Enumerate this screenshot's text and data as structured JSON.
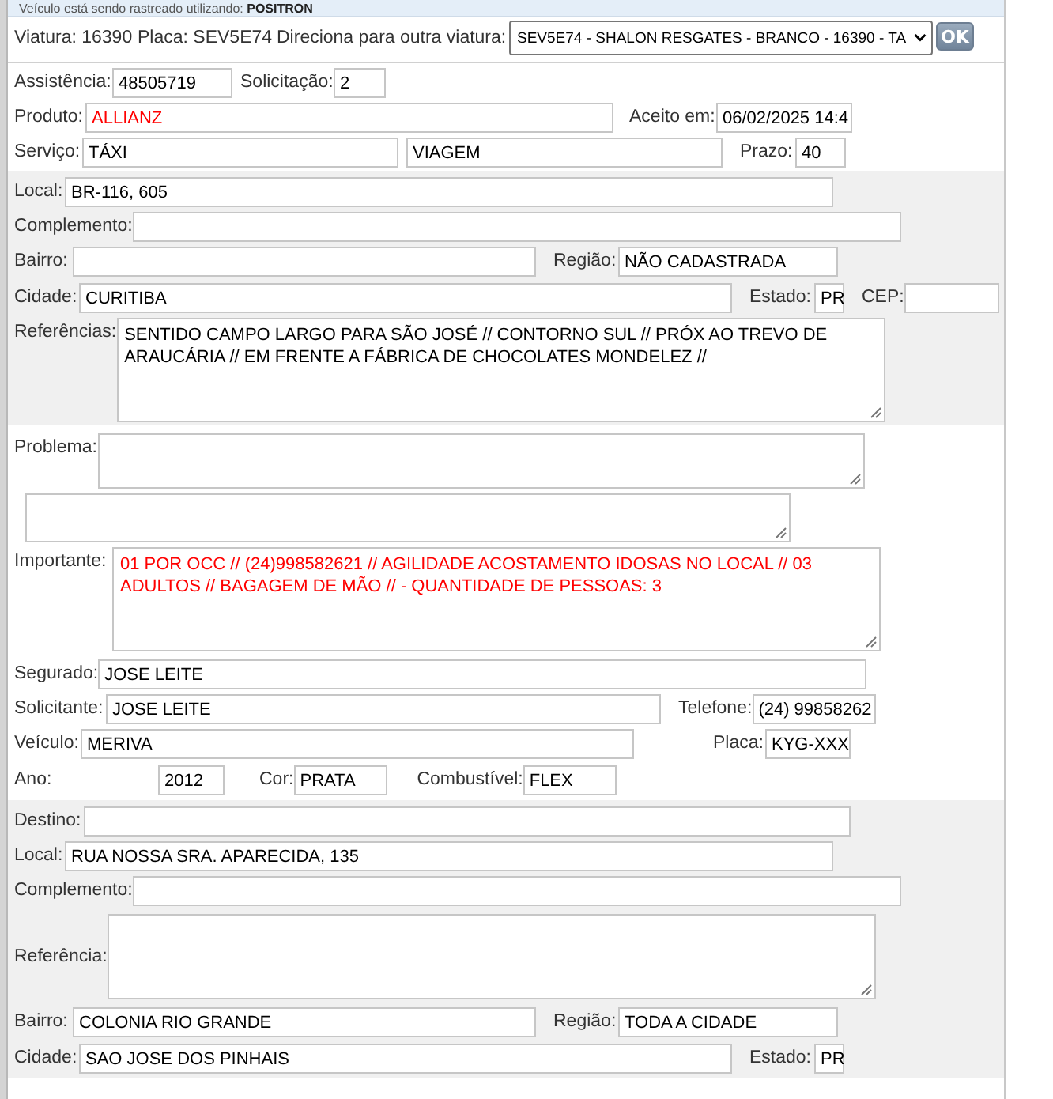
{
  "banner": {
    "label": "Veículo está sendo rastreado utilizando:",
    "value": "POSITRON"
  },
  "header": {
    "items": [
      {
        "kind": "label",
        "text": "Viatura: 16390"
      },
      {
        "kind": "label",
        "text": "Placa: SEV5E74"
      },
      {
        "kind": "label",
        "text": "Direciona para outra viatura:"
      },
      {
        "kind": "select",
        "value": "SEV5E74 - SHALON RESGATES - BRANCO - 16390 - TA"
      },
      {
        "kind": "button",
        "text": "OK"
      }
    ]
  },
  "sections": [
    {
      "shaded": false,
      "rows": [
        {
          "items": [
            {
              "kind": "label",
              "text": "Assistência:"
            },
            {
              "kind": "input",
              "value": "48505719",
              "alert": false
            },
            {
              "kind": "label",
              "text": "Solicitação:"
            },
            {
              "kind": "input",
              "value": "2",
              "alert": false
            }
          ]
        },
        {
          "items": [
            {
              "kind": "label",
              "text": "Produto:"
            },
            {
              "kind": "input",
              "value": "ALLIANZ",
              "alert": true
            },
            {
              "kind": "label",
              "text": "Aceito em:"
            },
            {
              "kind": "input",
              "value": "06/02/2025 14:4",
              "alert": false
            }
          ]
        },
        {
          "items": [
            {
              "kind": "label",
              "text": "Serviço:"
            },
            {
              "kind": "input",
              "value": "TÁXI",
              "alert": false
            },
            {
              "kind": "input",
              "value": "VIAGEM",
              "alert": false
            },
            {
              "kind": "label",
              "text": "Prazo:"
            },
            {
              "kind": "input",
              "value": "40",
              "alert": false
            }
          ]
        }
      ]
    },
    {
      "shaded": true,
      "rows": [
        {
          "items": [
            {
              "kind": "label",
              "text": "Local:"
            },
            {
              "kind": "input",
              "value": "BR-116, 605",
              "alert": false
            }
          ]
        },
        {
          "items": [
            {
              "kind": "label",
              "text": "Complemento:"
            },
            {
              "kind": "input"
            }
          ]
        },
        {
          "items": [
            {
              "kind": "label",
              "text": "Bairro:"
            },
            {
              "kind": "input"
            },
            {
              "kind": "label",
              "text": "Região:"
            },
            {
              "kind": "input",
              "value": "NÃO CADASTRADA",
              "alert": false
            }
          ]
        },
        {
          "items": [
            {
              "kind": "label",
              "text": "Cidade:"
            },
            {
              "kind": "input",
              "value": "CURITIBA",
              "alert": false
            },
            {
              "kind": "label",
              "text": "Estado:"
            },
            {
              "kind": "input",
              "value": "PR",
              "alert": false
            },
            {
              "kind": "label",
              "text": "CEP:"
            },
            {
              "kind": "input"
            }
          ]
        },
        {
          "items": [
            {
              "kind": "label",
              "text": "Referências:"
            },
            {
              "kind": "textarea",
              "value": "SENTIDO CAMPO LARGO PARA SÃO JOSÉ // CONTORNO SUL // PRÓX AO TREVO DE ARAUCÁRIA // EM FRENTE A FÁBRICA DE CHOCOLATES MONDELEZ //",
              "alert": false
            }
          ]
        }
      ]
    },
    {
      "shaded": false,
      "rows": [
        {
          "items": [
            {
              "kind": "label",
              "text": "Problema:"
            },
            {
              "kind": "textarea"
            }
          ]
        },
        {
          "items": [
            {
              "kind": "textarea"
            }
          ]
        },
        {
          "items": [
            {
              "kind": "label",
              "text": "Importante:"
            },
            {
              "kind": "textarea",
              "value": "01 POR OCC // (24)998582621 // AGILIDADE ACOSTAMENTO IDOSAS NO LOCAL // 03 ADULTOS // BAGAGEM DE MÃO // - QUANTIDADE DE PESSOAS: 3",
              "alert": true
            }
          ]
        },
        {
          "items": [
            {
              "kind": "label",
              "text": "Segurado:"
            },
            {
              "kind": "input",
              "value": "JOSE LEITE",
              "alert": false
            }
          ]
        },
        {
          "items": [
            {
              "kind": "label",
              "text": "Solicitante:"
            },
            {
              "kind": "input",
              "value": "JOSE LEITE",
              "alert": false
            },
            {
              "kind": "label",
              "text": "Telefone:"
            },
            {
              "kind": "input",
              "value": "(24) 99858262",
              "alert": false
            }
          ]
        },
        {
          "items": [
            {
              "kind": "label",
              "text": "Veículo:"
            },
            {
              "kind": "input",
              "value": "MERIVA",
              "alert": false
            },
            {
              "kind": "label",
              "text": "Placa:"
            },
            {
              "kind": "input",
              "value": "KYG-XXX",
              "alert": false
            }
          ]
        },
        {
          "items": [
            {
              "kind": "label",
              "text": "Ano:"
            },
            {
              "kind": "input",
              "value": "2012",
              "alert": false
            },
            {
              "kind": "label",
              "text": "Cor:"
            },
            {
              "kind": "input",
              "value": "PRATA",
              "alert": false
            },
            {
              "kind": "label",
              "text": "Combustível:"
            },
            {
              "kind": "input",
              "value": "FLEX",
              "alert": false
            }
          ]
        }
      ]
    },
    {
      "shaded": true,
      "rows": [
        {
          "items": [
            {
              "kind": "label",
              "text": "Destino:"
            },
            {
              "kind": "input"
            }
          ]
        },
        {
          "items": [
            {
              "kind": "label",
              "text": "Local:"
            },
            {
              "kind": "input",
              "value": "RUA NOSSA SRA. APARECIDA, 135",
              "alert": false
            }
          ]
        },
        {
          "items": [
            {
              "kind": "label",
              "text": "Complemento:"
            },
            {
              "kind": "input"
            }
          ]
        },
        {
          "items": [
            {
              "kind": "label",
              "text": "Referência:"
            },
            {
              "kind": "textarea"
            }
          ]
        },
        {
          "items": [
            {
              "kind": "label",
              "text": "Bairro:"
            },
            {
              "kind": "input",
              "value": "COLONIA RIO GRANDE",
              "alert": false
            },
            {
              "kind": "label",
              "text": "Região:"
            },
            {
              "kind": "input",
              "value": "TODA A CIDADE",
              "alert": false
            }
          ]
        },
        {
          "items": [
            {
              "kind": "label",
              "text": "Cidade:"
            },
            {
              "kind": "input",
              "value": "SAO JOSE DOS PINHAIS",
              "alert": false
            },
            {
              "kind": "label",
              "text": "Estado:"
            },
            {
              "kind": "input",
              "value": "PR",
              "alert": false
            }
          ]
        }
      ]
    }
  ]
}
